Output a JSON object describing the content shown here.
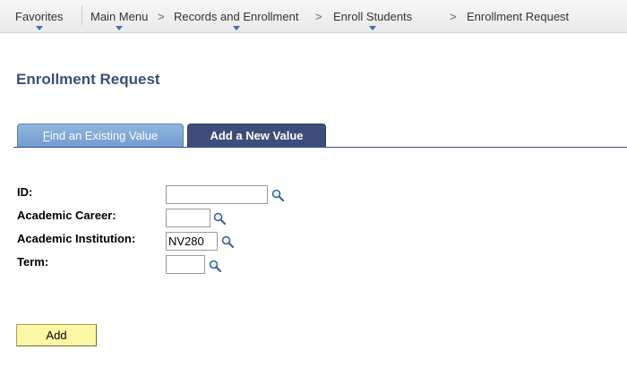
{
  "nav": {
    "favorites": "Favorites",
    "main_menu": "Main Menu",
    "crumb1": "Records and Enrollment",
    "crumb2": "Enroll Students",
    "crumb3": "Enrollment Request",
    "separator": ">"
  },
  "page": {
    "title": "Enrollment Request"
  },
  "tabs": {
    "find_existing": {
      "accel": "F",
      "rest": "ind an Existing Value"
    },
    "add_new": "Add a New Value"
  },
  "form": {
    "id": {
      "label": "ID:",
      "value": ""
    },
    "academic_career": {
      "label": "Academic Career:",
      "value": ""
    },
    "academic_institution": {
      "label": "Academic Institution:",
      "value": "NV280"
    },
    "term": {
      "label": "Term:",
      "value": ""
    }
  },
  "actions": {
    "add_label": "Add"
  },
  "colors": {
    "title": "#3b4f7a",
    "active_tab": "#3d4e7c",
    "inactive_tab": "#7ba4d4",
    "add_button": "#fbf7a4",
    "nav_caret": "#3a6fb0"
  },
  "icons": {
    "lookup": "magnifier-icon",
    "menu_caret": "caret-down-icon"
  }
}
